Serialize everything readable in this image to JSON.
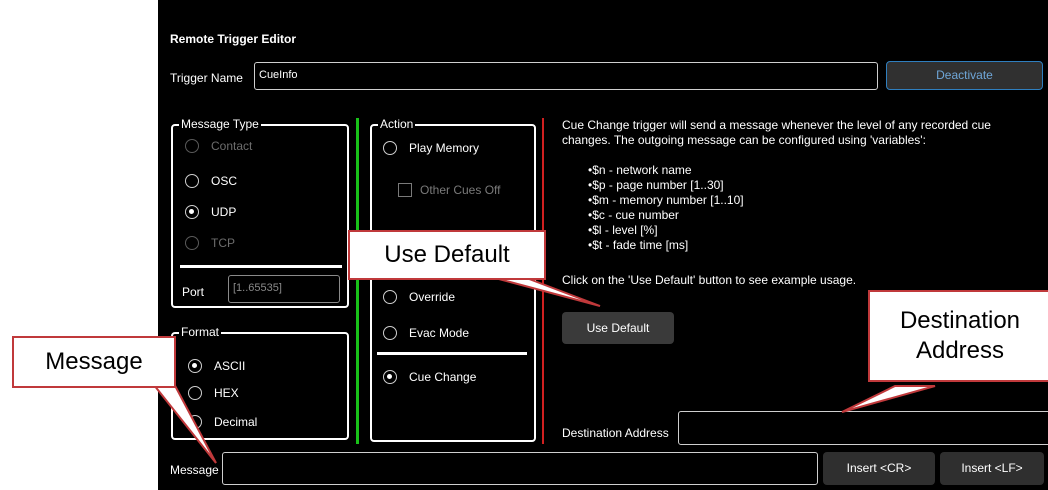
{
  "window": {
    "title": "Remote Trigger Editor"
  },
  "trigger": {
    "name_label": "Trigger Name",
    "name_value": "CueInfo",
    "deactivate_label": "Deactivate"
  },
  "message_type": {
    "legend": "Message Type",
    "options": [
      "Contact",
      "OSC",
      "UDP",
      "TCP"
    ],
    "selected": "UDP",
    "port_label": "Port",
    "port_placeholder": "[1..65535]"
  },
  "format": {
    "legend": "Format",
    "options": [
      "ASCII",
      "HEX",
      "Decimal"
    ],
    "selected": "ASCII"
  },
  "action": {
    "legend": "Action",
    "play_memory": "Play Memory",
    "other_cues_off": "Other Cues Off",
    "override": "Override",
    "evac_mode": "Evac Mode",
    "cue_change": "Cue Change",
    "selected": "Cue Change"
  },
  "info": {
    "description": "Cue Change trigger will send a message whenever the level of any recorded cue changes. The outgoing message can be configured using 'variables':",
    "variables": [
      "$n - network name",
      "$p - page number [1..30]",
      "$m - memory number [1..10]",
      "$c - cue number",
      "$l - level [%]",
      "$t - fade time [ms]"
    ],
    "hint": "Click on the 'Use Default' button to see example usage.",
    "use_default_label": "Use Default"
  },
  "destination": {
    "label": "Destination Address",
    "value": ""
  },
  "message": {
    "label": "Message",
    "value": "",
    "insert_cr": "Insert <CR>",
    "insert_lf": "Insert <LF>"
  },
  "callouts": {
    "use_default": "Use Default",
    "destination_line1": "Destination",
    "destination_line2": "Address",
    "message": "Message"
  },
  "colors": {
    "callout_border": "#c0393b",
    "green_divider": "#19c219",
    "red_divider": "#d02020",
    "deactivate_border": "#2f7fbf"
  }
}
